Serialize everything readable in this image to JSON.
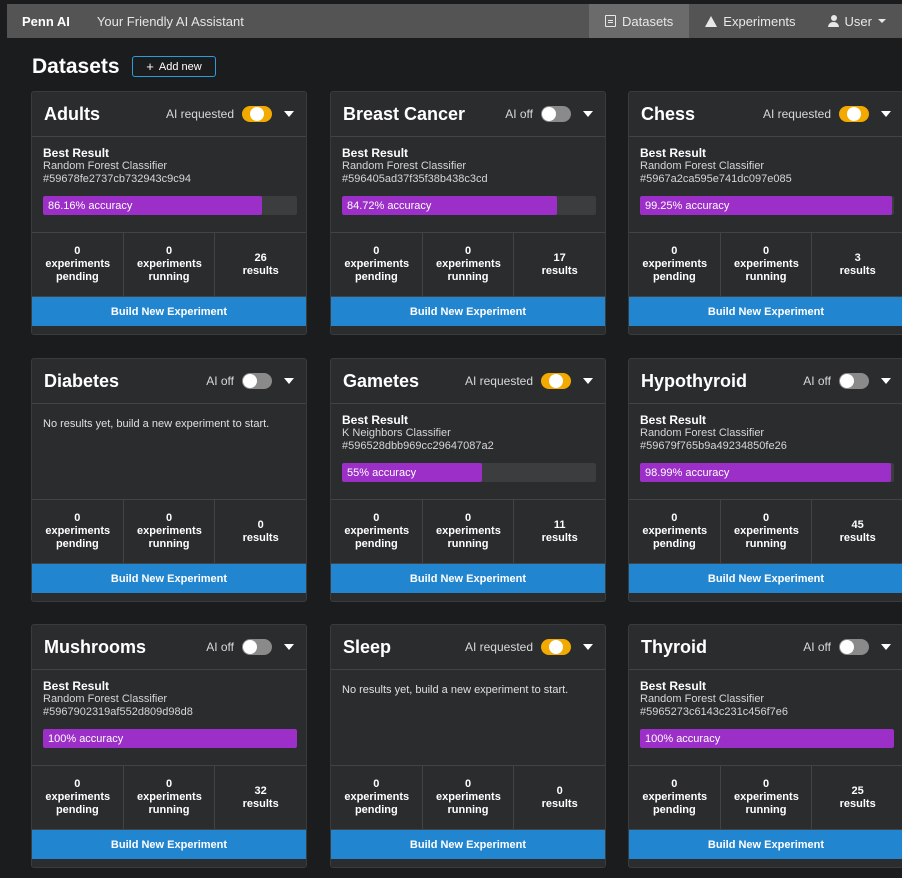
{
  "navbar": {
    "brand": "Penn AI",
    "tagline": "Your Friendly AI Assistant",
    "datasets": "Datasets",
    "experiments": "Experiments",
    "user": "User"
  },
  "header": {
    "title": "Datasets",
    "add_label": "Add new"
  },
  "labels": {
    "best_result": "Best Result",
    "build": "Build New Experiment",
    "empty": "No results yet, build a new experiment to start.",
    "pending": "experiments pending",
    "running": "experiments running",
    "results": "results"
  },
  "colors": {
    "accent": "#2185d0",
    "toggle_on": "#f2a900",
    "accuracy_bar": "#9b2fc7"
  },
  "datasets": [
    {
      "name": "Adults",
      "ai": "AI requested",
      "ai_on": true,
      "has_result": true,
      "algo": "Random Forest Classifier",
      "hash": "#59678fe2737cb732943c9c94",
      "accuracy": 86.16,
      "accuracy_label": "86.16% accuracy",
      "pending": "0",
      "running": "0",
      "results": "26"
    },
    {
      "name": "Breast Cancer",
      "ai": "AI off",
      "ai_on": false,
      "has_result": true,
      "algo": "Random Forest Classifier",
      "hash": "#596405ad37f35f38b438c3cd",
      "accuracy": 84.72,
      "accuracy_label": "84.72% accuracy",
      "pending": "0",
      "running": "0",
      "results": "17"
    },
    {
      "name": "Chess",
      "ai": "AI requested",
      "ai_on": true,
      "has_result": true,
      "algo": "Random Forest Classifier",
      "hash": "#5967a2ca595e741dc097e085",
      "accuracy": 99.25,
      "accuracy_label": "99.25% accuracy",
      "pending": "0",
      "running": "0",
      "results": "3"
    },
    {
      "name": "Diabetes",
      "ai": "AI off",
      "ai_on": false,
      "has_result": false,
      "pending": "0",
      "running": "0",
      "results": "0"
    },
    {
      "name": "Gametes",
      "ai": "AI requested",
      "ai_on": true,
      "has_result": true,
      "algo": "K Neighbors Classifier",
      "hash": "#596528dbb969cc29647087a2",
      "accuracy": 55,
      "accuracy_label": "55% accuracy",
      "pending": "0",
      "running": "0",
      "results": "11"
    },
    {
      "name": "Hypothyroid",
      "ai": "AI off",
      "ai_on": false,
      "has_result": true,
      "algo": "Random Forest Classifier",
      "hash": "#59679f765b9a49234850fe26",
      "accuracy": 98.99,
      "accuracy_label": "98.99% accuracy",
      "pending": "0",
      "running": "0",
      "results": "45"
    },
    {
      "name": "Mushrooms",
      "ai": "AI off",
      "ai_on": false,
      "has_result": true,
      "algo": "Random Forest Classifier",
      "hash": "#5967902319af552d809d98d8",
      "accuracy": 100,
      "accuracy_label": "100% accuracy",
      "pending": "0",
      "running": "0",
      "results": "32"
    },
    {
      "name": "Sleep",
      "ai": "AI requested",
      "ai_on": true,
      "has_result": false,
      "pending": "0",
      "running": "0",
      "results": "0"
    },
    {
      "name": "Thyroid",
      "ai": "AI off",
      "ai_on": false,
      "has_result": true,
      "algo": "Random Forest Classifier",
      "hash": "#5965273c6143c231c456f7e6",
      "accuracy": 100,
      "accuracy_label": "100% accuracy",
      "pending": "0",
      "running": "0",
      "results": "25"
    }
  ]
}
